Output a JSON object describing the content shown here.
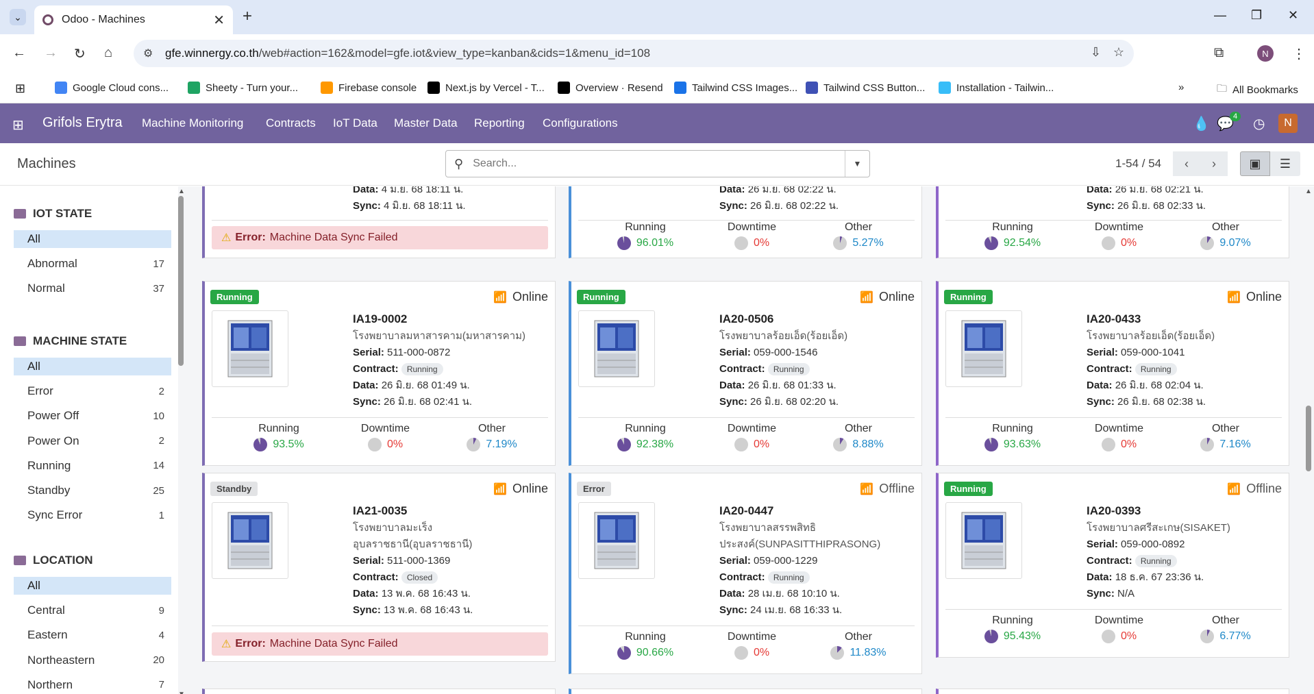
{
  "browser": {
    "tab_title": "Odoo - Machines",
    "url_host": "gfe.winnergy.co.th",
    "url_rest": "/web#action=162&model=gfe.iot&view_type=kanban&cids=1&menu_id=108",
    "profile_initial": "N",
    "bookmarks": [
      {
        "label": "Google Cloud cons...",
        "color": "#4285f4"
      },
      {
        "label": "Sheety - Turn your...",
        "color": "#1fa463"
      },
      {
        "label": "Firebase console",
        "color": "#ff9800"
      },
      {
        "label": "Next.js by Vercel - T...",
        "color": "#000000"
      },
      {
        "label": "Overview · Resend",
        "color": "#000000"
      },
      {
        "label": "Tailwind CSS Images...",
        "color": "#1a73e8"
      },
      {
        "label": "Tailwind CSS Button...",
        "color": "#3f51b5"
      },
      {
        "label": "Installation - Tailwin...",
        "color": "#38bdf8"
      }
    ],
    "all_bookmarks": "All Bookmarks"
  },
  "app": {
    "brand": "Grifols Erytra",
    "menu": [
      "Machine Monitoring",
      "Contracts",
      "IoT Data",
      "Master Data",
      "Reporting",
      "Configurations"
    ],
    "messages_count": "4",
    "user_initial": "N",
    "nav_color": "#71639e"
  },
  "control_panel": {
    "title": "Machines",
    "search_placeholder": "Search...",
    "pager": "1-54 / 54"
  },
  "sidebar": {
    "sections": [
      {
        "title": "IOT STATE",
        "items": [
          {
            "label": "All",
            "count": ""
          },
          {
            "label": "Abnormal",
            "count": "17"
          },
          {
            "label": "Normal",
            "count": "37"
          }
        ]
      },
      {
        "title": "MACHINE STATE",
        "items": [
          {
            "label": "All",
            "count": ""
          },
          {
            "label": "Error",
            "count": "2"
          },
          {
            "label": "Power Off",
            "count": "10"
          },
          {
            "label": "Power On",
            "count": "2"
          },
          {
            "label": "Running",
            "count": "14"
          },
          {
            "label": "Standby",
            "count": "25"
          },
          {
            "label": "Sync Error",
            "count": "1"
          }
        ]
      },
      {
        "title": "LOCATION",
        "items": [
          {
            "label": "All",
            "count": ""
          },
          {
            "label": "Central",
            "count": "9"
          },
          {
            "label": "Eastern",
            "count": "4"
          },
          {
            "label": "Northeastern",
            "count": "20"
          },
          {
            "label": "Northern",
            "count": "7"
          }
        ]
      }
    ]
  },
  "labels": {
    "serial": "Serial:",
    "contract": "Contract:",
    "data": "Data:",
    "sync": "Sync:",
    "running": "Running",
    "downtime": "Downtime",
    "other": "Other",
    "error_prefix": "Error:",
    "error_msg": "Machine Data Sync Failed"
  },
  "top_partial_cards": [
    {
      "data": "4 มิ.ย. 68 18:11 น.",
      "sync": "4 มิ.ย. 68 18:11 น.",
      "error": true
    },
    {
      "data": "26 มิ.ย. 68 02:22 น.",
      "sync": "26 มิ.ย. 68 02:22 น.",
      "running": "96.01%",
      "downtime": "0%",
      "other": "5.27%"
    },
    {
      "data": "26 มิ.ย. 68 02:21 น.",
      "sync": "26 มิ.ย. 68 02:33 น.",
      "running": "92.54%",
      "downtime": "0%",
      "other": "9.07%"
    }
  ],
  "cards": [
    {
      "state": "Running",
      "conn": "Online",
      "code": "IA19-0002",
      "hospital": "โรงพยาบาลมหาสารคาม(มหาสารคาม)",
      "serial": "511-000-0872",
      "contract": "Running",
      "data": "26 มิ.ย. 68 01:49 น.",
      "sync": "26 มิ.ย. 68 02:41 น.",
      "running": "93.5%",
      "downtime": "0%",
      "other": "7.19%"
    },
    {
      "state": "Running",
      "conn": "Online",
      "code": "IA20-0506",
      "hospital": "โรงพยาบาลร้อยเอ็ด(ร้อยเอ็ด)",
      "serial": "059-000-1546",
      "contract": "Running",
      "data": "26 มิ.ย. 68 01:33 น.",
      "sync": "26 มิ.ย. 68 02:20 น.",
      "running": "92.38%",
      "downtime": "0%",
      "other": "8.88%"
    },
    {
      "state": "Running",
      "conn": "Online",
      "code": "IA20-0433",
      "hospital": "โรงพยาบาลร้อยเอ็ด(ร้อยเอ็ด)",
      "serial": "059-000-1041",
      "contract": "Running",
      "data": "26 มิ.ย. 68 02:04 น.",
      "sync": "26 มิ.ย. 68 02:38 น.",
      "running": "93.63%",
      "downtime": "0%",
      "other": "7.16%"
    },
    {
      "state": "Standby",
      "conn": "Online",
      "code": "IA21-0035",
      "hospital": "โรงพยาบาลมะเร็งอุบลราชธานี(อุบลราชธานี)",
      "serial": "511-000-1369",
      "contract": "Closed",
      "data": "13 พ.ค. 68 16:43 น.",
      "sync": "13 พ.ค. 68 16:43 น.",
      "error": true
    },
    {
      "state": "Error",
      "conn": "Offline",
      "code": "IA20-0447",
      "hospital": "โรงพยาบาลสรรพสิทธิประสงค์(SUNPASITTHIPRASONG)",
      "serial": "059-000-1229",
      "contract": "Running",
      "data": "28 เม.ย. 68 10:10 น.",
      "sync": "24 เม.ย. 68 16:33 น.",
      "running": "90.66%",
      "downtime": "0%",
      "other": "11.83%"
    },
    {
      "state": "Running",
      "conn": "Offline",
      "code": "IA20-0393",
      "hospital": "โรงพยาบาลศรีสะเกษ(SISAKET)",
      "serial": "059-000-0892",
      "contract": "Running",
      "data": "18 ธ.ค. 67 23:36 น.",
      "sync": "N/A",
      "running": "95.43%",
      "downtime": "0%",
      "other": "6.77%"
    }
  ]
}
